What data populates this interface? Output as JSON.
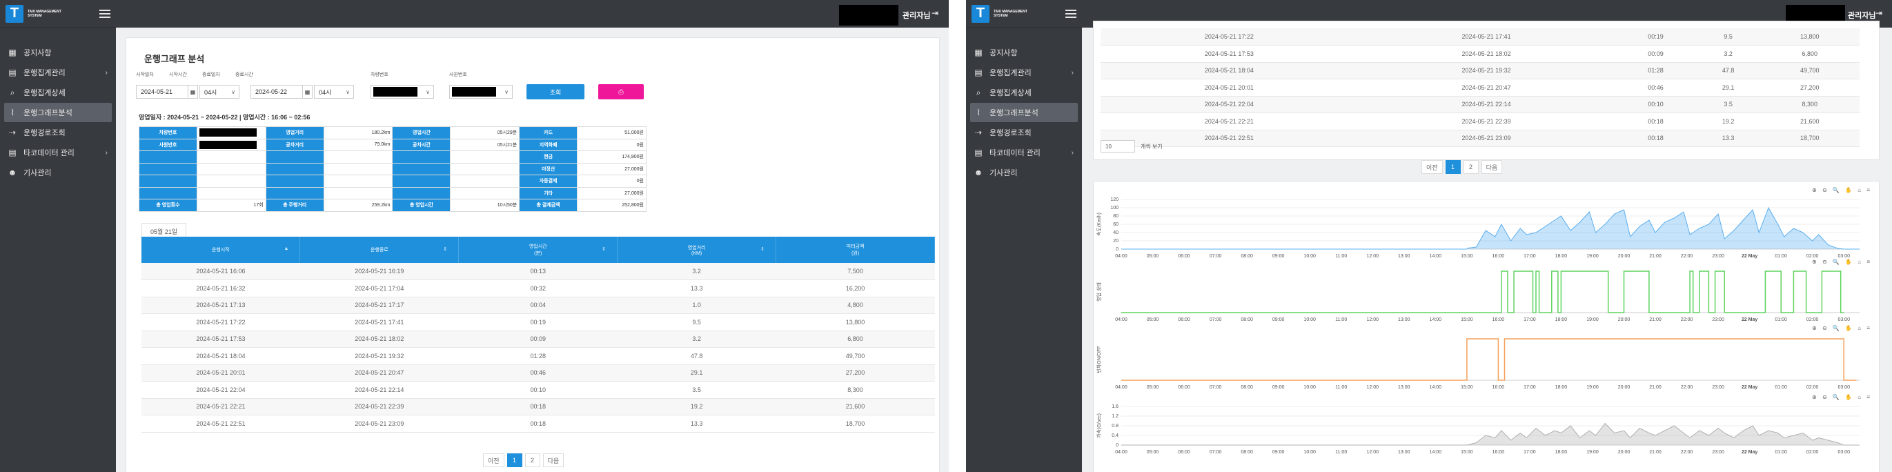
{
  "logo": {
    "letter": "T",
    "text": "TAXI MANAGEMENT SYSTEM"
  },
  "nav": [
    {
      "label": "공지사항",
      "icon": "calendar-icon",
      "glyph": "▦",
      "chevron": false
    },
    {
      "label": "운행집계관리",
      "icon": "list-card-icon",
      "glyph": "▤",
      "chevron": true
    },
    {
      "label": "운행집계상세",
      "icon": "search-icon",
      "glyph": "⌕",
      "chevron": false
    },
    {
      "label": "운행그래프분석",
      "icon": "line-chart-icon",
      "glyph": "⌇",
      "chevron": false,
      "active": true
    },
    {
      "label": "운행경로조회",
      "icon": "route-icon",
      "glyph": "⇢",
      "chevron": false
    },
    {
      "label": "타코데이터 관리",
      "icon": "card-icon",
      "glyph": "▤",
      "chevron": true
    },
    {
      "label": "기사관리",
      "icon": "users-icon",
      "glyph": "☻",
      "chevron": false
    }
  ],
  "topbar": {
    "admin": "관리자님",
    "logout_glyph": "⇥"
  },
  "page": {
    "title": "운행그래프 분석",
    "filters": {
      "start_date_label": "시작일자",
      "start_date": "2024-05-21",
      "start_time_label": "시작시간",
      "start_time": "04시",
      "end_date_label": "종료일자",
      "end_date": "2024-05-22",
      "end_time_label": "종료시간",
      "end_time": "04시",
      "vehicle_label": "차량번호",
      "company_label": "사원번호",
      "search_button": "조회",
      "print_glyph": "⎙"
    },
    "summary_line": "영업일자 : 2024-05-21 ~ 2024-05-22 | 영업시간 : 16:06 ~ 02:56",
    "summary": {
      "r1": {
        "l1": "차량번호",
        "l2": "영업거리",
        "v2": "180.2km",
        "l3": "영업시간",
        "v3": "05시29분",
        "l4": "카드",
        "v4": "51,000원"
      },
      "r2": {
        "l1": "사원번호",
        "l2": "공차거리",
        "v2": "79.0km",
        "l3": "공차시간",
        "v3": "05시21분",
        "l4": "지역화폐",
        "v4": "0원"
      },
      "r3": {
        "l4": "현금",
        "v4": "174,800원"
      },
      "r4": {
        "l4": "미정산",
        "v4": "27,000원"
      },
      "r5": {
        "l4": "자동결제",
        "v4": "0원"
      },
      "r6": {
        "l4": "기타",
        "v4": "27,000원"
      },
      "r7": {
        "l1": "총 영업횟수",
        "v1": "17회",
        "l2": "총 주행거리",
        "v2": "259.2km",
        "l3": "총 영업시간",
        "v3": "10시50분",
        "l4": "총 결제금액",
        "v4": "252,800원"
      }
    },
    "date_tab": "05월 21일",
    "table": {
      "headers": [
        "운행시작",
        "운행종료",
        "영업시간\n(분)",
        "영업거리\n(KM)",
        "미터금액\n(원)"
      ],
      "rows": [
        [
          "2024-05-21 16:06",
          "2024-05-21 16:19",
          "00:13",
          "3.2",
          "7,500"
        ],
        [
          "2024-05-21 16:32",
          "2024-05-21 17:04",
          "00:32",
          "13.3",
          "16,200"
        ],
        [
          "2024-05-21 17:13",
          "2024-05-21 17:17",
          "00:04",
          "1.0",
          "4,800"
        ],
        [
          "2024-05-21 17:22",
          "2024-05-21 17:41",
          "00:19",
          "9.5",
          "13,800"
        ],
        [
          "2024-05-21 17:53",
          "2024-05-21 18:02",
          "00:09",
          "3.2",
          "6,800"
        ],
        [
          "2024-05-21 18:04",
          "2024-05-21 19:32",
          "01:28",
          "47.8",
          "49,700"
        ],
        [
          "2024-05-21 20:01",
          "2024-05-21 20:47",
          "00:46",
          "29.1",
          "27,200"
        ],
        [
          "2024-05-21 22:04",
          "2024-05-21 22:14",
          "00:10",
          "3.5",
          "8,300"
        ],
        [
          "2024-05-21 22:21",
          "2024-05-21 22:39",
          "00:18",
          "19.2",
          "21,600"
        ],
        [
          "2024-05-21 22:51",
          "2024-05-21 23:09",
          "00:18",
          "13.3",
          "18,700"
        ]
      ],
      "rows_per_page": "10",
      "rows_label": "개씩 보기"
    },
    "pager": {
      "prev": "이전",
      "pages": [
        "1",
        "2"
      ],
      "next": "다음"
    }
  },
  "right_window": {
    "table_rows": [
      [
        "2024-05-21 17:22",
        "2024-05-21 17:41",
        "00:19",
        "9.5",
        "13,800"
      ],
      [
        "2024-05-21 17:53",
        "2024-05-21 18:02",
        "00:09",
        "3.2",
        "6,800"
      ],
      [
        "2024-05-21 18:04",
        "2024-05-21 19:32",
        "01:28",
        "47.8",
        "49,700"
      ],
      [
        "2024-05-21 20:01",
        "2024-05-21 20:47",
        "00:46",
        "29.1",
        "27,200"
      ],
      [
        "2024-05-21 22:04",
        "2024-05-21 22:14",
        "00:10",
        "3.5",
        "8,300"
      ],
      [
        "2024-05-21 22:21",
        "2024-05-21 22:39",
        "00:18",
        "19.2",
        "21,600"
      ],
      [
        "2024-05-21 22:51",
        "2024-05-21 23:09",
        "00:18",
        "13.3",
        "18,700"
      ]
    ],
    "chart_toolbar": "⊕ ⊖ 🔍 ✋ ⌂ ≡"
  },
  "chart_data": [
    {
      "type": "area",
      "ylabel": "속도(Km/h)",
      "ylim": [
        0,
        120
      ],
      "y_ticks": [
        "0",
        "20",
        "40",
        "60",
        "80",
        "100",
        "120"
      ],
      "x_ticks": [
        "04:00",
        "05:00",
        "06:00",
        "07:00",
        "08:00",
        "09:00",
        "10:00",
        "11:00",
        "12:00",
        "13:00",
        "14:00",
        "15:00",
        "16:00",
        "17:00",
        "18:00",
        "19:00",
        "20:00",
        "21:00",
        "22:00",
        "23:00",
        "22 May",
        "01:00",
        "02:00",
        "03:00"
      ],
      "color": "#5aaef0",
      "x": [
        15.0,
        15.3,
        15.6,
        15.9,
        16.1,
        16.4,
        16.7,
        16.9,
        17.2,
        17.5,
        17.8,
        18.0,
        18.3,
        18.6,
        18.9,
        19.1,
        19.4,
        19.7,
        20.0,
        20.2,
        20.5,
        20.8,
        21.0,
        21.3,
        21.6,
        21.9,
        22.1,
        22.4,
        22.7,
        23.0,
        23.2,
        23.5,
        23.8,
        24.1,
        24.3,
        24.6,
        24.9,
        25.1,
        25.4,
        25.7,
        26.0,
        26.2,
        26.5,
        26.8,
        27.0
      ],
      "y": [
        2,
        5,
        45,
        30,
        60,
        20,
        50,
        35,
        40,
        55,
        70,
        80,
        45,
        65,
        90,
        40,
        60,
        85,
        95,
        30,
        55,
        70,
        40,
        65,
        75,
        90,
        35,
        50,
        60,
        85,
        25,
        45,
        70,
        95,
        40,
        100,
        60,
        30,
        50,
        40,
        20,
        35,
        10,
        2,
        0
      ]
    },
    {
      "type": "line",
      "ylabel": "영업 상태",
      "ylim": [
        0,
        1
      ],
      "y_ticks": [],
      "x_ticks": [
        "04:00",
        "05:00",
        "06:00",
        "07:00",
        "08:00",
        "09:00",
        "10:00",
        "11:00",
        "12:00",
        "13:00",
        "14:00",
        "15:00",
        "16:00",
        "17:00",
        "18:00",
        "19:00",
        "20:00",
        "21:00",
        "22:00",
        "23:00",
        "22 May",
        "01:00",
        "02:00",
        "03:00"
      ],
      "color": "#5fd35f",
      "x": [
        4.0,
        16.1,
        16.1,
        16.3,
        16.3,
        16.5,
        16.5,
        17.1,
        17.1,
        17.2,
        17.2,
        17.3,
        17.3,
        17.7,
        17.7,
        17.9,
        17.9,
        18.0,
        18.0,
        18.1,
        18.1,
        19.5,
        19.5,
        20.0,
        20.0,
        20.8,
        20.8,
        22.1,
        22.1,
        22.2,
        22.2,
        22.4,
        22.4,
        22.7,
        22.7,
        22.9,
        22.9,
        23.2,
        23.2,
        24.5,
        24.5,
        25.0,
        25.0,
        25.4,
        25.4,
        25.8,
        25.8,
        26.3,
        26.3,
        26.9,
        26.9,
        27.0
      ],
      "y": [
        0,
        0,
        1,
        1,
        0,
        0,
        1,
        1,
        0,
        0,
        1,
        1,
        0,
        0,
        1,
        1,
        0,
        0,
        1,
        1,
        1,
        1,
        0,
        0,
        1,
        1,
        0,
        0,
        1,
        1,
        0,
        0,
        1,
        1,
        0,
        0,
        1,
        1,
        0,
        0,
        1,
        1,
        0,
        0,
        1,
        1,
        0,
        0,
        1,
        1,
        0,
        0
      ]
    },
    {
      "type": "line",
      "ylabel": "빈차ON/OFF",
      "ylim": [
        0,
        1
      ],
      "y_ticks": [],
      "x_ticks": [
        "04:00",
        "05:00",
        "06:00",
        "07:00",
        "08:00",
        "09:00",
        "10:00",
        "11:00",
        "12:00",
        "13:00",
        "14:00",
        "15:00",
        "16:00",
        "17:00",
        "18:00",
        "19:00",
        "20:00",
        "21:00",
        "22:00",
        "23:00",
        "22 May",
        "01:00",
        "02:00",
        "03:00"
      ],
      "color": "#f5a05a",
      "x": [
        4.0,
        15.0,
        15.0,
        16.0,
        16.0,
        16.2,
        16.2,
        27.0,
        27.0,
        27.4
      ],
      "y": [
        0,
        0,
        1,
        1,
        0,
        0,
        1,
        1,
        0,
        0
      ]
    },
    {
      "type": "area",
      "ylabel": "가속(G/sec)",
      "ylim": [
        0,
        1.6
      ],
      "y_ticks": [
        "0",
        "0.4",
        "0.8",
        "1.2",
        "1.6"
      ],
      "x_ticks": [
        "04:00",
        "05:00",
        "06:00",
        "07:00",
        "08:00",
        "09:00",
        "10:00",
        "11:00",
        "12:00",
        "13:00",
        "14:00",
        "15:00",
        "16:00",
        "17:00",
        "18:00",
        "19:00",
        "20:00",
        "21:00",
        "22:00",
        "23:00",
        "22 May",
        "01:00",
        "02:00",
        "03:00"
      ],
      "color": "#b0b0b0",
      "x": [
        15.0,
        15.3,
        15.6,
        15.9,
        16.1,
        16.4,
        16.7,
        16.9,
        17.2,
        17.5,
        17.8,
        18.0,
        18.3,
        18.6,
        18.9,
        19.1,
        19.4,
        19.7,
        20.0,
        20.2,
        20.5,
        20.8,
        21.0,
        21.3,
        21.6,
        21.9,
        22.1,
        22.4,
        22.7,
        23.0,
        23.2,
        23.5,
        23.8,
        24.1,
        24.3,
        24.6,
        24.9,
        25.1,
        25.4,
        25.7,
        26.0,
        26.2,
        26.5,
        26.8,
        27.0
      ],
      "y": [
        0.0,
        0.1,
        0.4,
        0.3,
        0.6,
        0.2,
        0.5,
        0.3,
        0.7,
        0.4,
        0.6,
        0.5,
        0.8,
        0.3,
        0.6,
        0.4,
        0.9,
        0.5,
        0.6,
        0.3,
        0.7,
        0.5,
        0.4,
        0.6,
        0.8,
        0.5,
        0.3,
        0.6,
        0.4,
        0.7,
        0.5,
        0.3,
        0.6,
        0.8,
        0.4,
        0.6,
        0.5,
        0.3,
        0.4,
        0.5,
        0.2,
        0.3,
        0.2,
        0.1,
        0.0
      ]
    }
  ]
}
